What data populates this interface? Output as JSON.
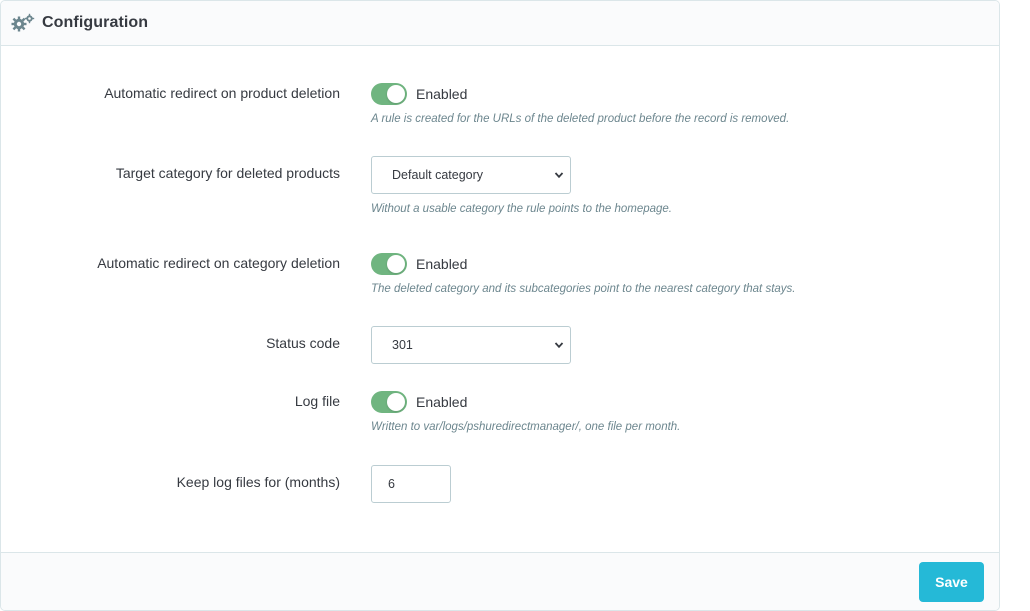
{
  "panel": {
    "title": "Configuration",
    "title_icon": "gears-icon"
  },
  "fields": {
    "product_redirect": {
      "label": "Automatic redirect on product deletion",
      "toggle_state": "Enabled",
      "help": "A rule is created for the URLs of the deleted product before the record is removed."
    },
    "target_category": {
      "label": "Target category for deleted products",
      "selected": "Default category",
      "help": "Without a usable category the rule points to the homepage."
    },
    "category_redirect": {
      "label": "Automatic redirect on category deletion",
      "toggle_state": "Enabled",
      "help": "The deleted category and its subcategories point to the nearest category that stays."
    },
    "status_code": {
      "label": "Status code",
      "selected": "301"
    },
    "log_file": {
      "label": "Log file",
      "toggle_state": "Enabled",
      "help": "Written to var/logs/pshuredirectmanager/, one file per month."
    },
    "keep_logs": {
      "label": "Keep log files for (months)",
      "value": "6"
    }
  },
  "footer": {
    "save_label": "Save"
  },
  "colors": {
    "toggle_on": "#70b580",
    "primary_button": "#25b9d7",
    "help_text": "#6c868e",
    "border": "#bbcdd2"
  }
}
